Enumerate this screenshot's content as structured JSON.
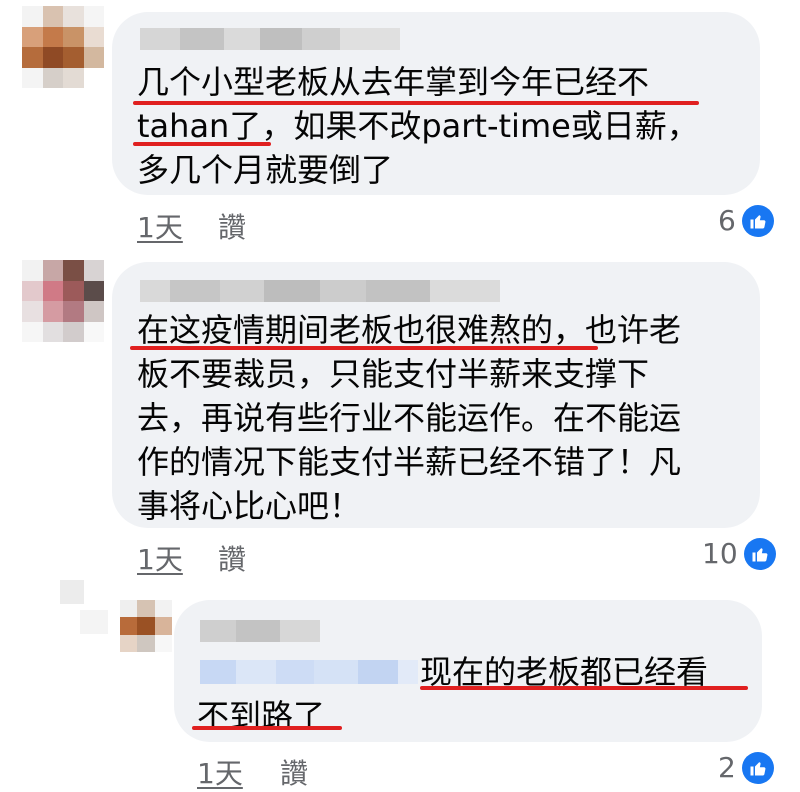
{
  "comments": [
    {
      "lines": [
        "几个小型老板从去年掌到今年已经不",
        "tahan了，如果不改part-time或日薪，",
        "多几个月就要倒了"
      ],
      "time": "1天",
      "like_label": "讚",
      "reaction_count": "6"
    },
    {
      "lines": [
        "在这疫情期间老板也很难熬的，也许老",
        "板不要裁员，只能支付半薪来支撑下",
        "去，再说有些行业不能运作。在不能运",
        "作的情况下能支付半薪已经不错了！凡",
        "事将心比心吧！"
      ],
      "time": "1天",
      "like_label": "讚",
      "reaction_count": "10"
    },
    {
      "lines": [
        "现在的老板都已经看",
        "不到路了"
      ],
      "time": "1天",
      "like_label": "讚",
      "reaction_count": "2"
    }
  ],
  "colors": {
    "bubble": "#f0f2f5",
    "underline": "#e02020",
    "like_blue": "#1877f2",
    "meta_text": "#65676b"
  },
  "icons": [
    "like-thumb-icon"
  ]
}
